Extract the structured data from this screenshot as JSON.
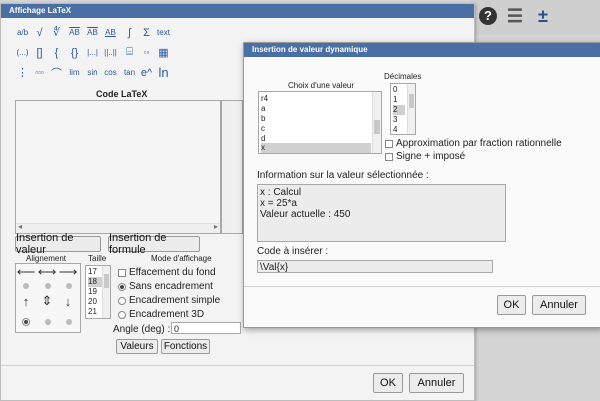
{
  "main_dialog": {
    "title": "Affichage LaTeX",
    "latex_code_label": "Code LaTeX",
    "insert_value_button": "Insertion de valeur",
    "insert_formula_button": "Insertion de formule",
    "alignment_label": "Alignement",
    "size_label": "Taille",
    "sizes": [
      "17",
      "18",
      "19",
      "20",
      "21"
    ],
    "selected_size": "18",
    "display_mode_label": "Mode d'affichage",
    "fill_background_label": "Effacement du fond",
    "modes": [
      "Sans encadrement",
      "Encadrement simple",
      "Encadrement 3D"
    ],
    "angle_label": "Angle (deg) :",
    "angle_value": "0",
    "values_button": "Valeurs",
    "functions_button": "Fonctions",
    "ok_button": "OK",
    "cancel_button": "Annuler"
  },
  "symbols": {
    "row1": [
      "a/b",
      "√",
      "∜",
      "AB",
      "AB",
      "AB",
      "∫",
      "Σ",
      "text"
    ],
    "row2": [
      "(...)",
      "[]",
      "{",
      "{}",
      "|...|",
      "||..||",
      "⌸",
      "▫▫",
      "▦"
    ],
    "row3": [
      "⋮",
      "▫▫▫",
      "⌒",
      "lim",
      "sin",
      "cos",
      "tan",
      "e^",
      "ln"
    ]
  },
  "value_dialog": {
    "title": "Insertion de valeur dynamique",
    "choose_value_label": "Choix d'une valeur",
    "values": [
      "r4",
      "a",
      "b",
      "c",
      "d",
      "x"
    ],
    "selected_value": "x",
    "decimals_label": "Décimales",
    "decimals": [
      "0",
      "1",
      "2",
      "3",
      "4"
    ],
    "selected_decimal": "2",
    "approx_label": "Approximation par fraction rationnelle",
    "sign_label": "Signe + imposé",
    "info_label": "Information sur la valeur sélectionnée :",
    "info_lines": [
      "x : Calcul",
      "x = 25*a",
      "Valeur actuelle :  450"
    ],
    "code_label": "Code à insérer :",
    "code_value": "\\Val{x}",
    "ok_button": "OK",
    "cancel_button": "Annuler"
  },
  "toolbar": {
    "help_icon": "?",
    "menu_icon": "☰",
    "move_icon": "±"
  }
}
